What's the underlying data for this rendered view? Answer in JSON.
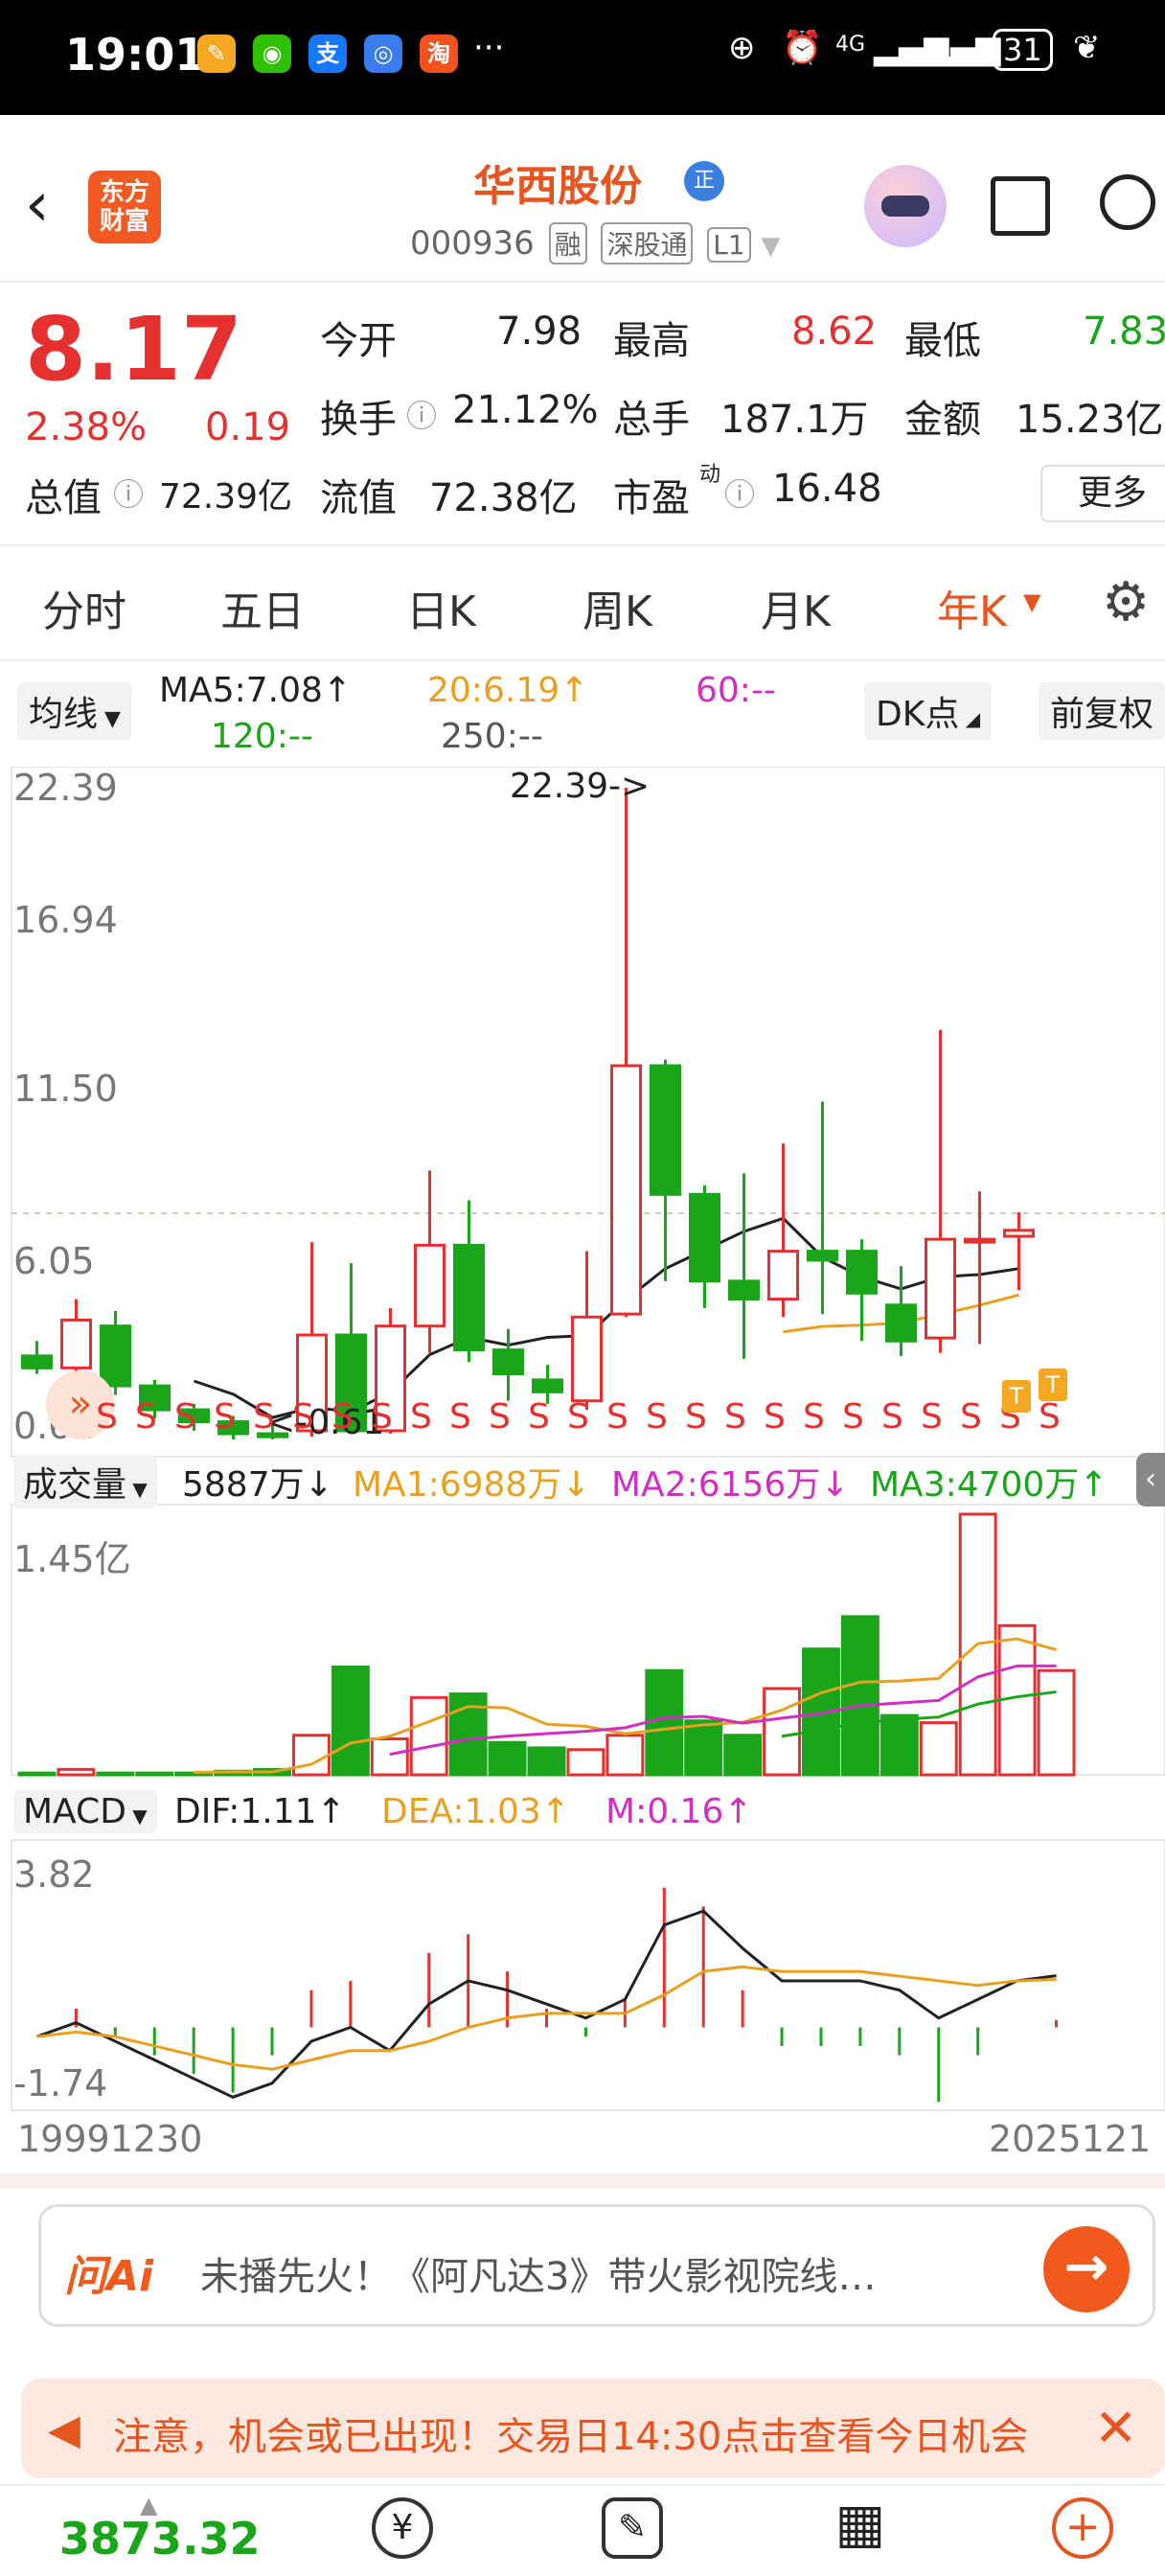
{
  "status_bar": {
    "time": "19:01",
    "network": "4G",
    "battery": "31"
  },
  "header": {
    "logo_line1": "东方",
    "logo_line2": "财富",
    "stock_name": "华西股份",
    "badge": "正",
    "stock_code": "000936",
    "tags": [
      "融",
      "深股通",
      "L1"
    ]
  },
  "quote": {
    "price": "8.17",
    "change_pct": "2.38%",
    "change_amt": "0.19",
    "open_label": "今开",
    "open_value": "7.98",
    "high_label": "最高",
    "high_value": "8.62",
    "low_label": "最低",
    "low_value": "7.83",
    "turnover_label": "换手",
    "turnover_value": "21.12%",
    "volume_label": "总手",
    "volume_value": "187.1万",
    "amount_label": "金额",
    "amount_value": "15.23亿",
    "mcap_label": "总值",
    "mcap_value": "72.39亿",
    "float_label": "流值",
    "float_value": "72.38亿",
    "pe_label": "市盈",
    "pe_sup": "动",
    "pe_value": "16.48",
    "more_label": "更多"
  },
  "tabs": [
    "分时",
    "五日",
    "日K",
    "周K",
    "月K",
    "年K"
  ],
  "active_tab": "年K",
  "ma_legend": {
    "selector": "均线",
    "ma5": "MA5:7.08↑",
    "ma20": "20:6.19↑",
    "ma60": "60:--",
    "ma120": "120:--",
    "ma250": "250:--",
    "dk": "DK点",
    "adjust": "前复权"
  },
  "kline_axis": [
    "22.39",
    "16.94",
    "11.50",
    "6.05",
    "0.61"
  ],
  "kline_annotations": {
    "high_marker": "22.39->",
    "low_marker": "<-0.61"
  },
  "volume": {
    "selector": "成交量",
    "current": "5887万↓",
    "ma1": "MA1:6988万↓",
    "ma2": "MA2:6156万↓",
    "ma3": "MA3:4700万↑",
    "axis_top": "1.45亿"
  },
  "macd": {
    "selector": "MACD",
    "dif": "DIF:1.11↑",
    "dea": "DEA:1.03↑",
    "m": "M:0.16↑",
    "axis_top": "3.82",
    "axis_bottom": "-1.74"
  },
  "date_axis": {
    "start": "19991230",
    "end": "2025121"
  },
  "ai_bar": {
    "logo": "问Ai",
    "text": "未播先火！《阿凡达3》带火影视院线…"
  },
  "notice": {
    "text": "注意，机会或已出现！交易日14:30点击查看今日机会"
  },
  "bottom": {
    "index_value": "3873.32"
  },
  "colors": {
    "up": "#e53030",
    "down": "#1aa51a",
    "accent": "#e6541f",
    "ma5": "#222222",
    "ma20": "#e8a020",
    "ma60": "#d030c0"
  },
  "chart_data": {
    "type": "candlestick",
    "x": [
      2000,
      2001,
      2002,
      2003,
      2004,
      2005,
      2006,
      2007,
      2008,
      2009,
      2010,
      2011,
      2012,
      2013,
      2014,
      2015,
      2016,
      2017,
      2018,
      2019,
      2020,
      2021,
      2022,
      2023,
      2024,
      2025
    ],
    "ylim": [
      0.61,
      22.39
    ],
    "candles": [
      {
        "o": 3.4,
        "c": 3.0,
        "h": 3.9,
        "l": 2.8
      },
      {
        "o": 3.0,
        "c": 4.6,
        "h": 5.3,
        "l": 2.7
      },
      {
        "o": 4.4,
        "c": 2.4,
        "h": 4.9,
        "l": 2.1
      },
      {
        "o": 2.4,
        "c": 1.6,
        "h": 2.6,
        "l": 1.3
      },
      {
        "o": 1.6,
        "c": 1.2,
        "h": 1.8,
        "l": 0.9
      },
      {
        "o": 1.2,
        "c": 0.8,
        "h": 1.4,
        "l": 0.61
      },
      {
        "o": 0.8,
        "c": 0.7,
        "h": 1.1,
        "l": 0.61
      },
      {
        "o": 0.9,
        "c": 4.1,
        "h": 7.2,
        "l": 0.7
      },
      {
        "o": 4.1,
        "c": 0.9,
        "h": 6.5,
        "l": 0.8
      },
      {
        "o": 0.9,
        "c": 4.4,
        "h": 5.0,
        "l": 0.8
      },
      {
        "o": 4.4,
        "c": 7.1,
        "h": 9.6,
        "l": 3.5
      },
      {
        "o": 7.1,
        "c": 3.6,
        "h": 8.6,
        "l": 3.2
      },
      {
        "o": 3.6,
        "c": 2.8,
        "h": 4.3,
        "l": 1.9
      },
      {
        "o": 2.6,
        "c": 2.2,
        "h": 3.1,
        "l": 1.8
      },
      {
        "o": 1.9,
        "c": 4.7,
        "h": 6.9,
        "l": 1.6
      },
      {
        "o": 4.8,
        "c": 13.1,
        "h": 22.39,
        "l": 4.7
      },
      {
        "o": 13.1,
        "c": 8.8,
        "h": 13.3,
        "l": 5.9
      },
      {
        "o": 8.8,
        "c": 5.9,
        "h": 9.1,
        "l": 5.0
      },
      {
        "o": 5.9,
        "c": 5.3,
        "h": 9.5,
        "l": 3.3
      },
      {
        "o": 5.3,
        "c": 6.9,
        "h": 10.5,
        "l": 4.7
      },
      {
        "o": 6.9,
        "c": 6.6,
        "h": 11.9,
        "l": 4.8
      },
      {
        "o": 6.9,
        "c": 5.5,
        "h": 7.3,
        "l": 3.9
      },
      {
        "o": 5.1,
        "c": 3.9,
        "h": 6.4,
        "l": 3.4
      },
      {
        "o": 4.0,
        "c": 7.3,
        "h": 14.3,
        "l": 3.5
      },
      {
        "o": 7.3,
        "c": 7.3,
        "h": 8.9,
        "l": 3.8
      },
      {
        "o": 7.4,
        "c": 7.6,
        "h": 8.2,
        "l": 5.6
      }
    ],
    "volume_ylim": [
      0,
      1.45
    ],
    "volume": [
      0.01,
      0.03,
      0.01,
      0.01,
      0.01,
      0.02,
      0.03,
      0.22,
      0.6,
      0.2,
      0.43,
      0.45,
      0.18,
      0.15,
      0.14,
      0.22,
      0.58,
      0.3,
      0.22,
      0.48,
      0.7,
      0.88,
      0.33,
      0.29,
      1.45,
      0.83,
      0.58
    ],
    "macd_ylim": [
      -1.74,
      3.82
    ],
    "dif": [
      -0.2,
      0.1,
      -0.3,
      -0.7,
      -1.1,
      -1.5,
      -1.2,
      -0.3,
      0.0,
      -0.5,
      0.5,
      1.0,
      0.8,
      0.5,
      0.2,
      0.6,
      2.2,
      2.5,
      1.7,
      1.0,
      1.0,
      1.0,
      0.8,
      0.2,
      0.6,
      1.0,
      1.11
    ],
    "dea": [
      -0.2,
      -0.1,
      -0.2,
      -0.4,
      -0.6,
      -0.8,
      -0.9,
      -0.7,
      -0.5,
      -0.5,
      -0.3,
      0.0,
      0.2,
      0.3,
      0.3,
      0.3,
      0.7,
      1.2,
      1.3,
      1.2,
      1.2,
      1.2,
      1.1,
      1.0,
      0.9,
      1.0,
      1.03
    ]
  }
}
